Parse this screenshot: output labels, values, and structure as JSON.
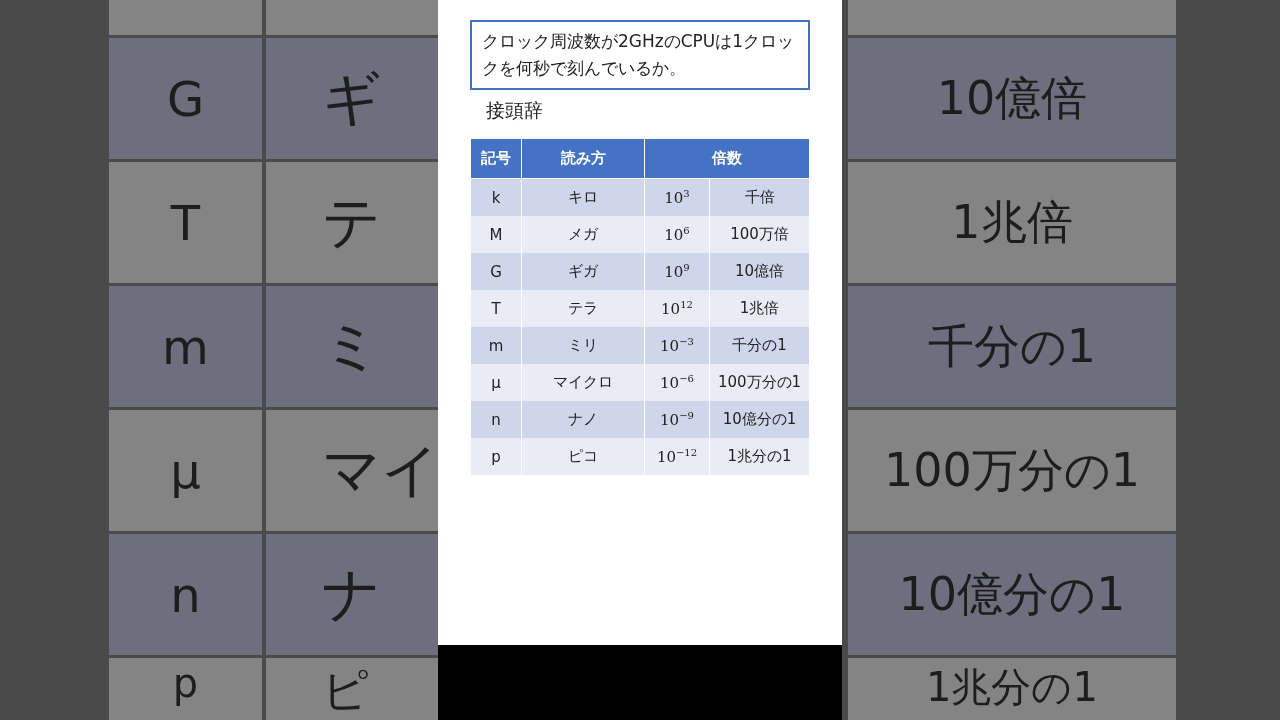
{
  "slide": {
    "question": "クロック周波数が2GHzのCPUは1クロックを何秒で刻んでいるか。",
    "heading": "接頭辞",
    "table": {
      "columns": [
        "記号",
        "読み方",
        "倍数"
      ],
      "rows": [
        {
          "symbol": "k",
          "reading": "キロ",
          "power": "10$^{3}$",
          "multiple": "千倍"
        },
        {
          "symbol": "M",
          "reading": "メガ",
          "power": "10$^{6}$",
          "multiple": "100万倍"
        },
        {
          "symbol": "G",
          "reading": "ギガ",
          "power": "10$^{9}$",
          "multiple": "10億倍"
        },
        {
          "symbol": "T",
          "reading": "テラ",
          "power": "10$^{12}$",
          "multiple": "1兆倍"
        },
        {
          "symbol": "m",
          "reading": "ミリ",
          "power": "10$^{−3}$",
          "multiple": "千分の1"
        },
        {
          "symbol": "μ",
          "reading": "マイクロ",
          "power": "10$^{−6}$",
          "multiple": "100万分の1"
        },
        {
          "symbol": "n",
          "reading": "ナノ",
          "power": "10$^{−9}$",
          "multiple": "10億分の1"
        },
        {
          "symbol": "p",
          "reading": "ピコ",
          "power": "10$^{−12}$",
          "multiple": "1兆分の1"
        }
      ]
    }
  },
  "backdrop": {
    "rows": [
      {
        "symbol": "G",
        "reading": "ギ",
        "multiple": "10億倍"
      },
      {
        "symbol": "T",
        "reading": "テ",
        "multiple": "1兆倍"
      },
      {
        "symbol": "m",
        "reading": "ミ",
        "multiple": "千分の1"
      },
      {
        "symbol": "μ",
        "reading": "マイ",
        "multiple": "100万分の1"
      },
      {
        "symbol": "n",
        "reading": "ナ",
        "multiple": "10億分の1"
      },
      {
        "symbol": "p",
        "reading": "ピ",
        "multiple": "1兆分の1"
      }
    ]
  }
}
